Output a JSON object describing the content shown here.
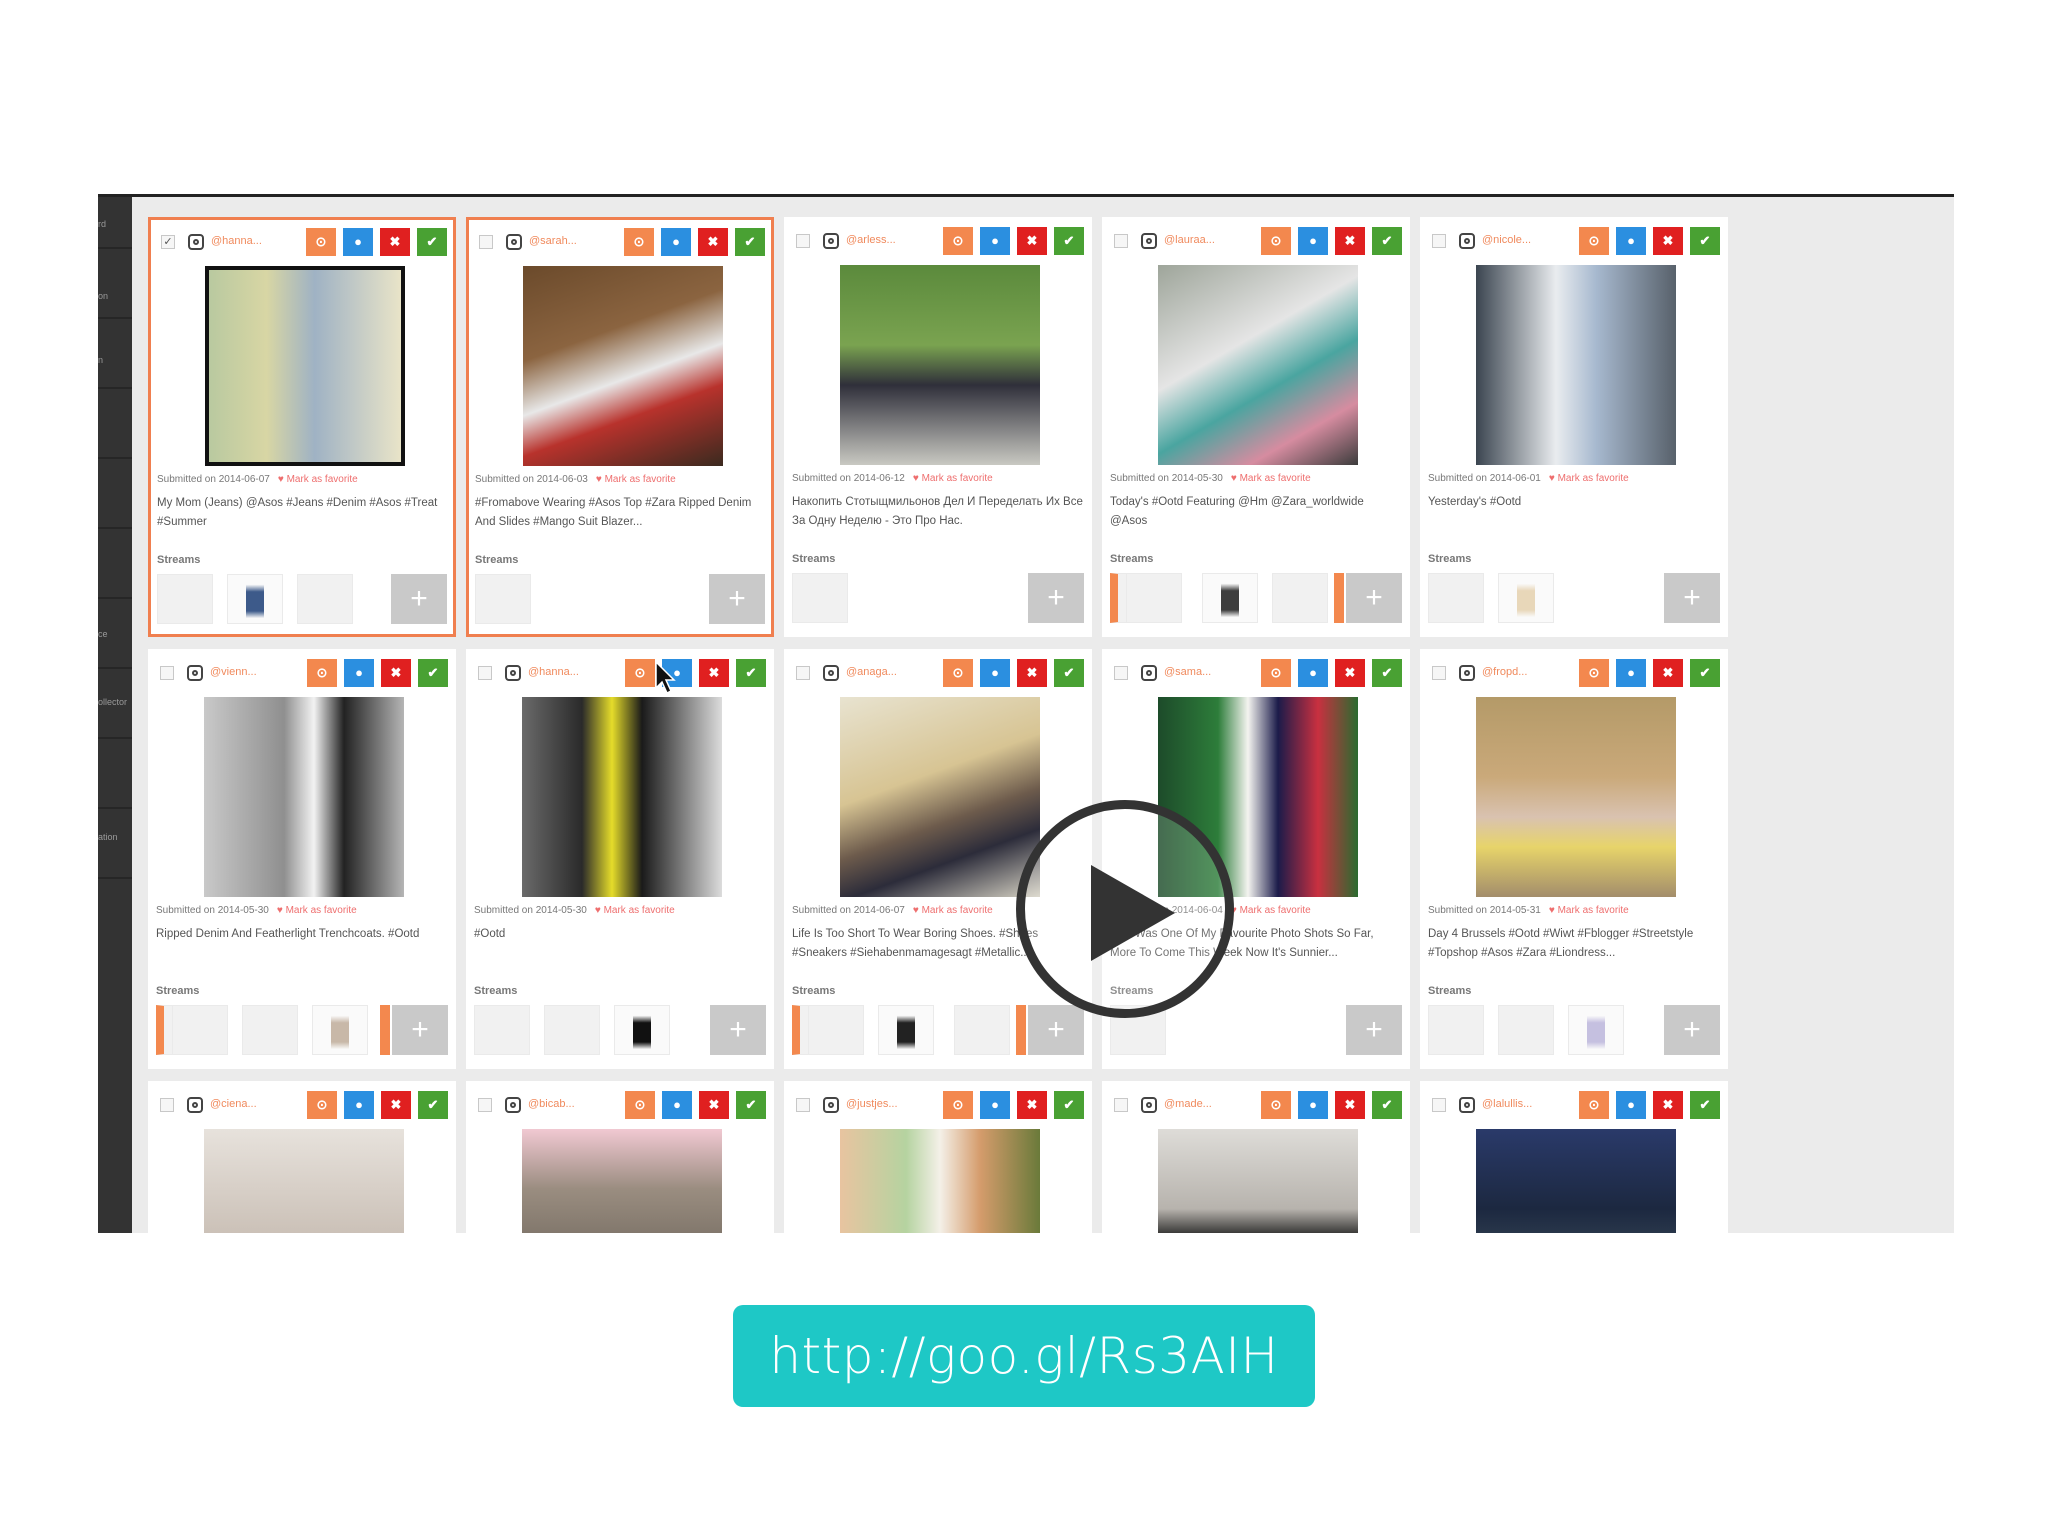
{
  "video": {
    "sidebar_labels": [
      "rd",
      "on",
      "n",
      "",
      "",
      "",
      "ce",
      "ollector",
      "",
      "ation"
    ],
    "streams_label": "Streams",
    "fav_label": "Mark as favorite",
    "cards": [
      {
        "user": "@hanna...",
        "date": "Submitted on 2014-06-07",
        "caption": "My Mom (Jeans) @Asos #Jeans #Denim #Asos #Treat #Summer",
        "checked": "✓"
      },
      {
        "user": "@sarah...",
        "date": "Submitted on 2014-06-03",
        "caption": "#Fromabove Wearing #Asos Top #Zara Ripped Denim And Slides #Mango Suit Blazer...",
        "checked": ""
      },
      {
        "user": "@arless...",
        "date": "Submitted on 2014-06-12",
        "caption": "Накопить Стотыщмильонов Дел И Переделать Их Все За Одну Неделю - Это Про Нас.",
        "checked": ""
      },
      {
        "user": "@lauraa...",
        "date": "Submitted on 2014-05-30",
        "caption": "Today's #Ootd Featuring @Hm @Zara_worldwide @Asos",
        "checked": ""
      },
      {
        "user": "@nicole...",
        "date": "Submitted on 2014-06-01",
        "caption": "Yesterday's #Ootd",
        "checked": ""
      },
      {
        "user": "@vienn...",
        "date": "Submitted on 2014-05-30",
        "caption": "Ripped Denim And Featherlight Trenchcoats. #Ootd",
        "checked": ""
      },
      {
        "user": "@hanna...",
        "date": "Submitted on 2014-05-30",
        "caption": "#Ootd",
        "checked": ""
      },
      {
        "user": "@anaga...",
        "date": "Submitted on 2014-06-07",
        "caption": "Life Is Too Short To Wear Boring Shoes. #Shoes #Sneakers #Siehabenmamagesagt #Metallic...",
        "checked": ""
      },
      {
        "user": "@sama...",
        "date": "Submitted on 2014-06-04",
        "caption": "This Was One Of My Favourite Photo Shots So Far, More To Come This Week Now It's Sunnier...",
        "checked": ""
      },
      {
        "user": "@fropd...",
        "date": "Submitted on 2014-05-31",
        "caption": "Day 4 Brussels #Ootd #Wiwt #Fblogger #Streetstyle #Topshop #Asos #Zara #Liondress...",
        "checked": ""
      },
      {
        "user": "@ciena...",
        "date": "",
        "caption": "",
        "checked": ""
      },
      {
        "user": "@bicab...",
        "date": "",
        "caption": "",
        "checked": ""
      },
      {
        "user": "@justjes...",
        "date": "",
        "caption": "",
        "checked": ""
      },
      {
        "user": "@made...",
        "date": "",
        "caption": "",
        "checked": ""
      },
      {
        "user": "@lalullis...",
        "date": "",
        "caption": "",
        "checked": ""
      }
    ],
    "action_icons": {
      "orange": "clock-icon",
      "blue": "comment-icon",
      "red": "close-icon",
      "green": "check-icon"
    },
    "plus_label": "+"
  },
  "url": {
    "text": "http://goo.gl/Rs3AIH"
  },
  "colors": {
    "accent_teal": "#1ec8c6",
    "selected_border": "#f07f4f"
  }
}
